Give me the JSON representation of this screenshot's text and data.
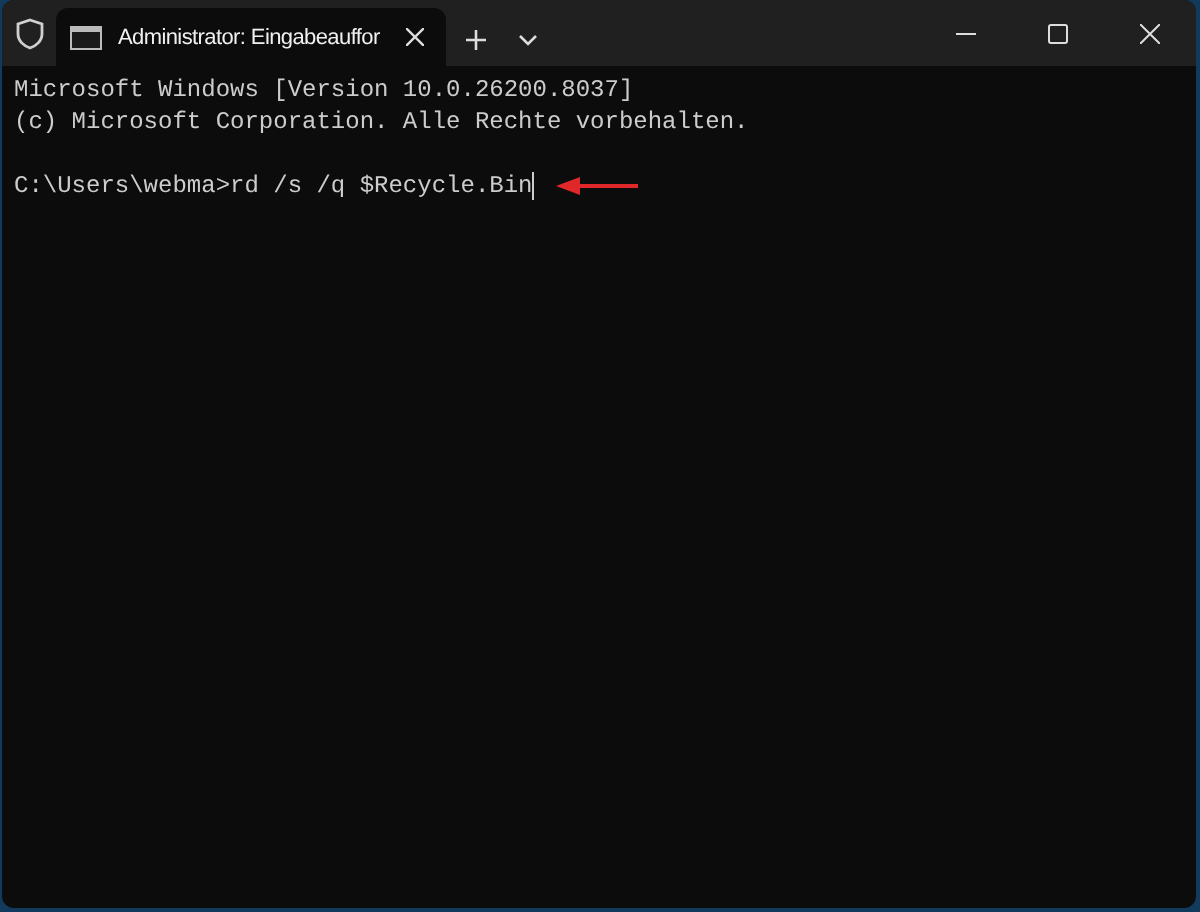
{
  "window": {
    "tabs": [
      {
        "title": "Administrator: Eingabeauffor",
        "selected": true
      }
    ]
  },
  "terminal": {
    "lines": [
      {
        "text": "Microsoft Windows [Version 10.0.26200.8037]"
      },
      {
        "text": "(c) Microsoft Corporation. Alle Rechte vorbehalten."
      },
      {
        "kind": "blank"
      },
      {
        "text": "C:\\Users\\webma>rd /s /q $Recycle.Bin",
        "cursor": true
      }
    ]
  }
}
